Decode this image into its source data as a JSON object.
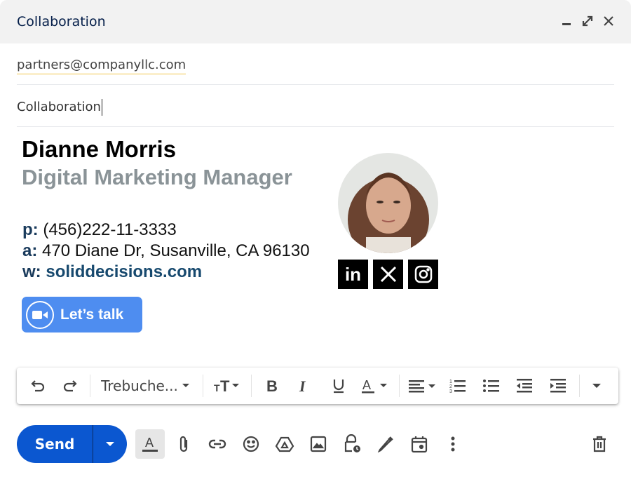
{
  "header": {
    "title": "Collaboration",
    "icons": [
      "minimize-icon",
      "expand-icon",
      "close-icon"
    ]
  },
  "to": {
    "recipient": "partners@companyllc.com"
  },
  "subject": {
    "value": "Collaboration"
  },
  "signature": {
    "name": "Dianne Morris",
    "title": "Digital Marketing Manager",
    "phone_label": "p:",
    "phone": "(456)222-11-3333",
    "address_label": "a:",
    "address": "470 Diane Dr, Susanville, CA 96130",
    "web_label": "w:",
    "web": "soliddecisions.com",
    "socials": [
      "linkedin",
      "x",
      "instagram"
    ],
    "cta_label": "Let’s talk",
    "colors": {
      "title": "#8a9397",
      "labels": "#1a3b5c",
      "cta": "#4e8df0"
    }
  },
  "format_bar": {
    "font": "Trebuche...",
    "buttons": [
      "undo",
      "redo",
      "font",
      "text-size",
      "bold",
      "italic",
      "underline",
      "text-color",
      "align",
      "numbered-list",
      "bulleted-list",
      "indent-less",
      "indent-more",
      "more-formatting"
    ]
  },
  "bottom_bar": {
    "send_label": "Send",
    "send_color": "#0b57d0",
    "icons": [
      "formatting-options",
      "attach",
      "link",
      "emoji",
      "drive",
      "photo",
      "confidential",
      "signature",
      "schedule",
      "more-options",
      "discard"
    ]
  }
}
